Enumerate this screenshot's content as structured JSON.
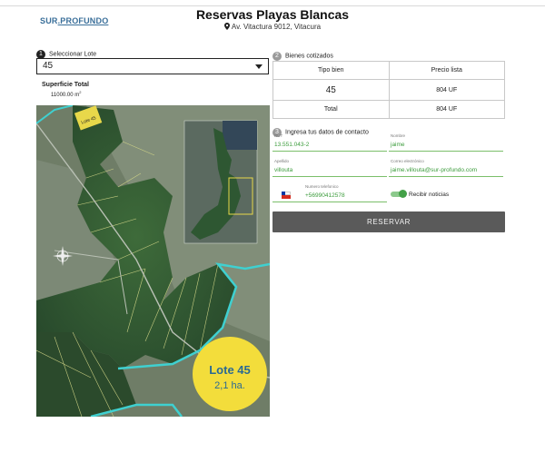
{
  "header": {
    "logo_a": "SUR",
    "logo_b": ".PROFUNDO",
    "title": "Reservas Playas Blancas",
    "address": "Av. Vitactura 9012, Vitacura"
  },
  "step1": {
    "number": "1",
    "label": "Seleccionar Lote",
    "selected": "45",
    "superficie_label": "Superficie Total",
    "superficie_value": "11000.00 m",
    "superficie_unit_sup": "2"
  },
  "map": {
    "corner_label": "Lote 45",
    "badge_title": "Lote 45",
    "badge_subtitle": "2,1 ha."
  },
  "step2": {
    "number": "2",
    "label": "Bienes cotizados",
    "headers": [
      "Tipo bien",
      "Precio lista"
    ],
    "rows": [
      {
        "tipo": "45",
        "precio": "804 UF"
      },
      {
        "tipo": "Total",
        "precio": "804 UF"
      }
    ]
  },
  "step3": {
    "number": "3",
    "label": "Ingresa tus datos de contacto",
    "rut_label": "RUT",
    "rut_value": "13.551.043-2",
    "nombre_label": "Nombre",
    "nombre_value": "jaime",
    "apellido_label": "Apellido",
    "apellido_value": "villouta",
    "correo_label": "Correo electrónico",
    "correo_value": "jaime.villouta@sur-profundo.com",
    "telefono_label": "Numero telefonico",
    "telefono_value": "+56990412578",
    "noticias_label": "Recibir noticias"
  },
  "actions": {
    "reservar_label": "RESERVAR"
  },
  "colors": {
    "accent_green": "#43a047",
    "button_grey": "#5a5a5a",
    "water_cyan": "#3fd0d0",
    "badge_yellow": "#f3dd3b",
    "highlight_yellow": "#e8d84a"
  }
}
